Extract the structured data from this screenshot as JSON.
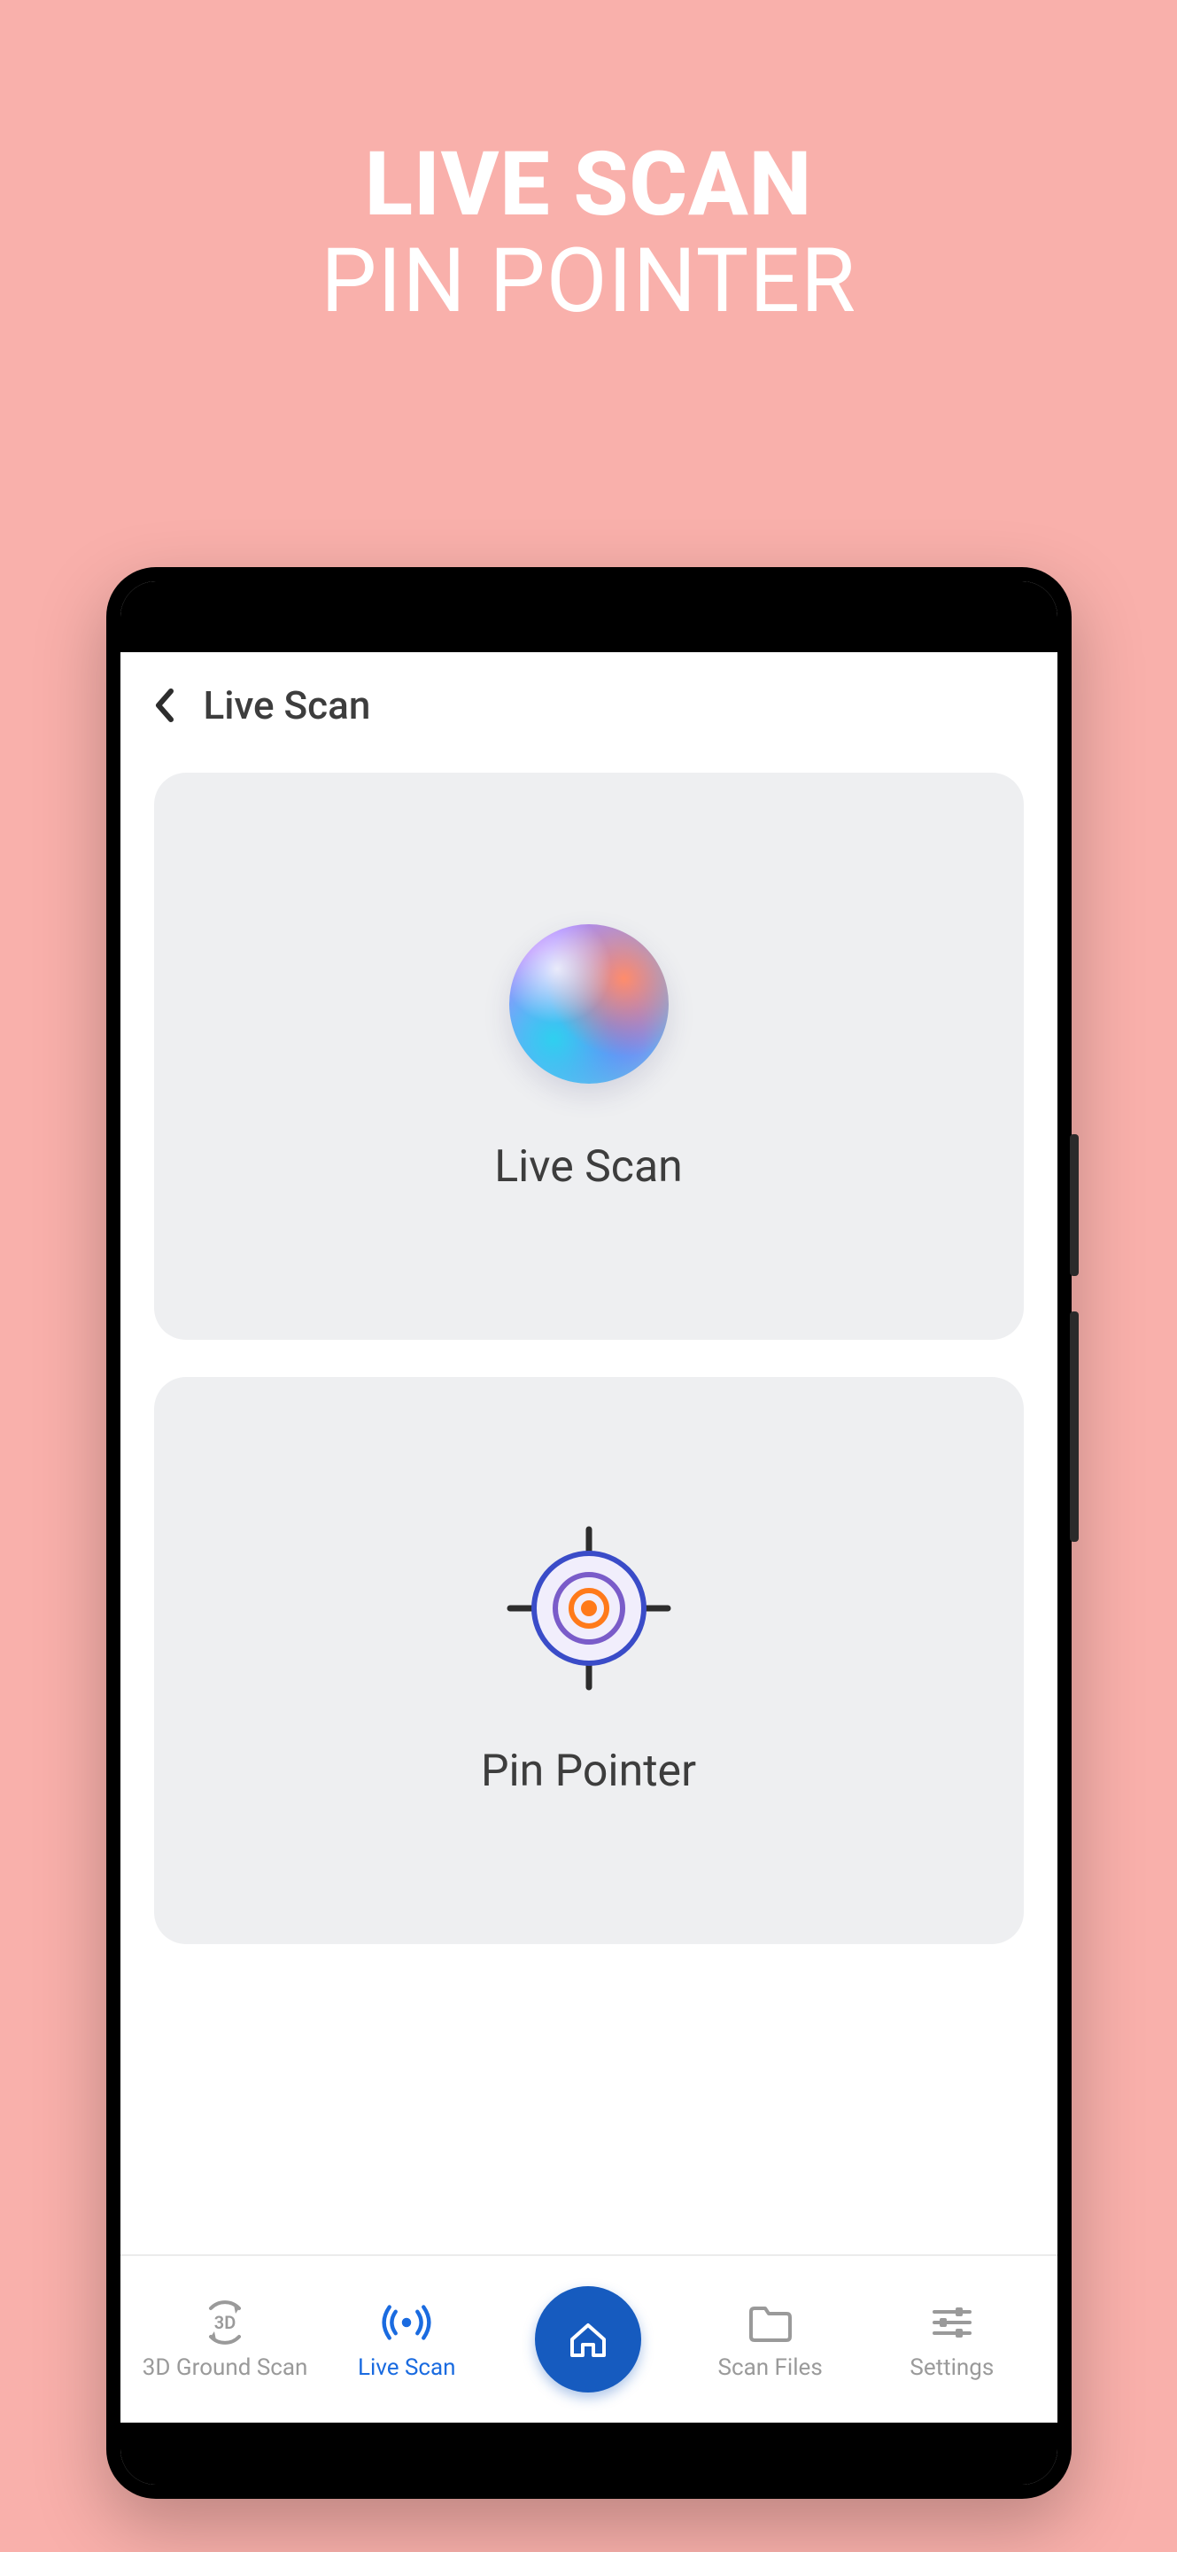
{
  "hero": {
    "line1": "LIVE SCAN",
    "line2": "PIN POINTER"
  },
  "header": {
    "title": "Live Scan"
  },
  "cards": [
    {
      "label": "Live Scan",
      "icon": "gradient-orb"
    },
    {
      "label": "Pin Pointer",
      "icon": "crosshair-target"
    }
  ],
  "tabs": [
    {
      "label": "3D Ground Scan",
      "icon": "3d-scan",
      "active": false
    },
    {
      "label": "Live Scan",
      "icon": "signal",
      "active": true
    },
    {
      "label": "",
      "icon": "home",
      "active": false
    },
    {
      "label": "Scan Files",
      "icon": "folder",
      "active": false
    },
    {
      "label": "Settings",
      "icon": "sliders",
      "active": false
    }
  ],
  "colors": {
    "accent": "#1a6be0",
    "homeButton": "#165bbf",
    "cardBg": "#eeeff1",
    "pageBg": "#f9b0ab"
  }
}
